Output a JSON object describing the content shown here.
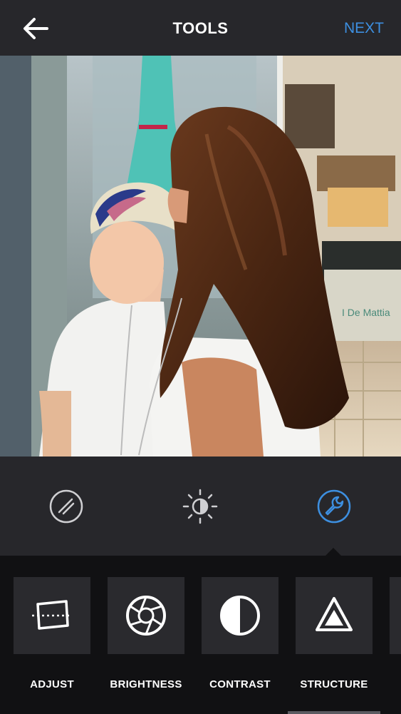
{
  "header": {
    "back_icon": "arrow-left-icon",
    "title": "TOOLS",
    "next_label": "NEXT",
    "accent_color": "#3d8fe0"
  },
  "photo": {
    "storefront_text": "I De Mattia"
  },
  "modes": [
    {
      "name": "lux",
      "icon": "lux-wand-icon",
      "active": false
    },
    {
      "name": "filter",
      "icon": "sun-half-icon",
      "active": false
    },
    {
      "name": "tools",
      "icon": "wrench-icon",
      "active": true
    }
  ],
  "tools": [
    {
      "label": "ADJUST",
      "icon": "adjust-rotate-icon"
    },
    {
      "label": "BRIGHTNESS",
      "icon": "aperture-icon"
    },
    {
      "label": "CONTRAST",
      "icon": "contrast-icon"
    },
    {
      "label": "STRUCTURE",
      "icon": "triangle-icon"
    }
  ]
}
